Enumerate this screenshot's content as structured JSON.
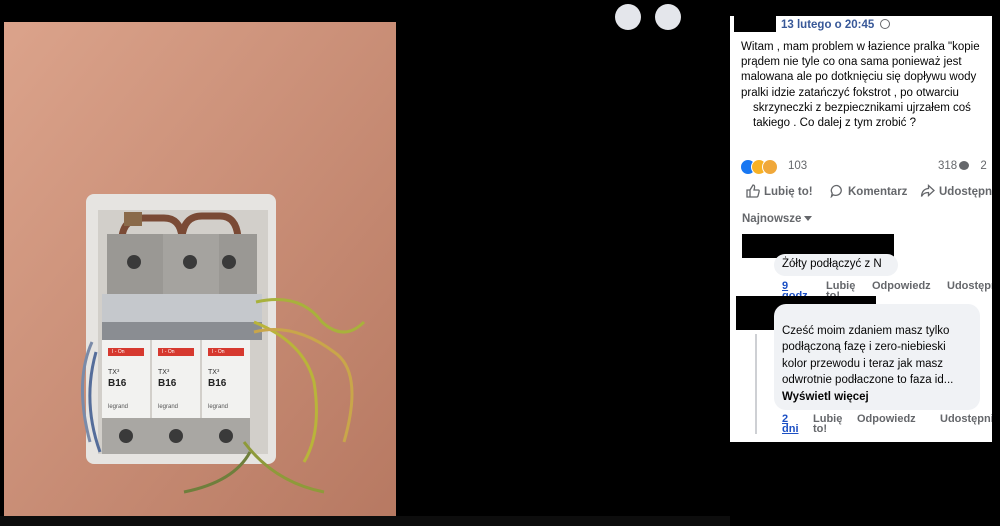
{
  "post": {
    "date": "13 lutego o 20:45",
    "text_lines": [
      "Witam , mam problem w łazience pralka \"kopie",
      "prądem nie tyle co ona sama ponieważ jest",
      "malowana ale po dotknięciu się dopływu wody",
      "pralki idzie zatańczyć fokstrot , po otwarciu",
      "skrzyneczki z bezpiecznikami ujrzałem coś",
      "takiego . Co dalej z tym zrobić ?"
    ],
    "reaction_count": "103",
    "comment_count": "318",
    "share_count": "2",
    "reaction_colors": [
      "#1877f2",
      "#f7b125",
      "#f0a83a"
    ]
  },
  "actions": {
    "like": "Lubię to!",
    "comment": "Komentarz",
    "share": "Udostępnij"
  },
  "comments_sort": "Najnowsze",
  "comments": [
    {
      "text_lines": [
        "Żółty podłączyć z N"
      ],
      "time_line1": "9",
      "time_line2": "godz.",
      "like": "Lubię to!",
      "reply": "Odpowiedz",
      "share": "Udostępnij"
    },
    {
      "text_lines": [
        "Cześć moim zdaniem masz tylko",
        "podłączoną fazę i zero-niebieski",
        "kolor przewodu i teraz jak masz",
        "odwrotnie podłaczone to faza id..."
      ],
      "more": "Wyświetl więcej",
      "time_line1": "2",
      "time_line2": "dni",
      "like": "Lubię to!",
      "reply": "Odpowiedz",
      "share": "Udostępnij"
    }
  ],
  "breakers": [
    {
      "brand": "TX³",
      "rating": "B16",
      "maker": "legrand",
      "state": "I - On"
    },
    {
      "brand": "TX³",
      "rating": "B16",
      "maker": "legrand",
      "state": "I - On"
    },
    {
      "brand": "TX³",
      "rating": "B16",
      "maker": "legrand",
      "state": "I - On"
    }
  ],
  "colors": {
    "link": "#385898",
    "meta": "#65676b",
    "bubble": "#f0f2f5",
    "background": "#000000"
  }
}
